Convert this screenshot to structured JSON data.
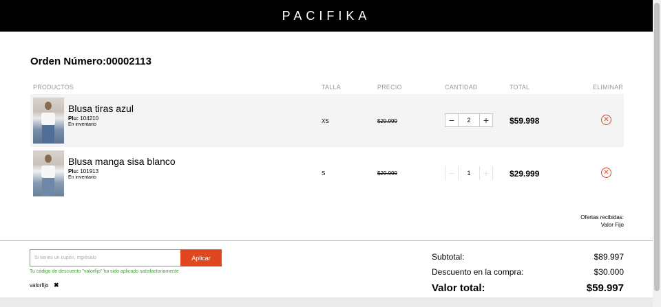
{
  "header": {
    "brand": "PACIFIKA"
  },
  "order": {
    "title": "Orden Número:00002113"
  },
  "columns": {
    "products": "PRODUCTOS",
    "size": "TALLA",
    "price": "PRECIO",
    "quantity": "CANTIDAD",
    "total": "TOTAL",
    "remove": "ELIMINAR"
  },
  "items": [
    {
      "name": "Blusa tiras azul",
      "plu_label": "Plu:",
      "plu": "104210",
      "stock": "En inventario",
      "size": "XS",
      "price": "$29.999",
      "quantity": "2",
      "total": "$59.998"
    },
    {
      "name": "Blusa manga sisa blanco",
      "plu_label": "Plu:",
      "plu": "101913",
      "stock": "En inventario",
      "size": "S",
      "price": "$29.999",
      "quantity": "1",
      "total": "$29.999"
    }
  ],
  "offers": {
    "title": "Ofertas recibidas:",
    "value": "Valor Fijo"
  },
  "coupon": {
    "placeholder": "Si tienes un cupón, ingrésalo",
    "apply_label": "Aplicar",
    "success_message": "Tu código de descuento \"valorfijo\" ha sido aplicado satisfactoriamente",
    "applied_code": "valorfijo"
  },
  "summary": {
    "subtotal_label": "Subtotal:",
    "subtotal_value": "$89.997",
    "discount_label": "Descuento en la compra:",
    "discount_value": "$30.000",
    "total_label": "Valor total:",
    "total_value": "$59.997"
  },
  "colors": {
    "accent": "#e0461f",
    "success": "#3fa232",
    "header_bg": "#000000"
  }
}
